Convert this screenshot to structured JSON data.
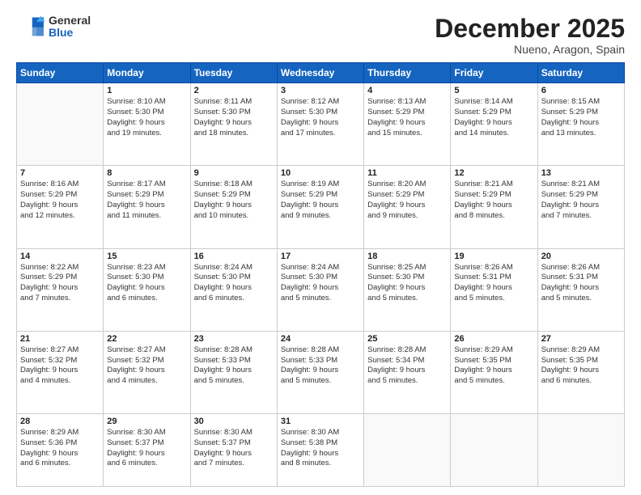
{
  "logo": {
    "general": "General",
    "blue": "Blue"
  },
  "header": {
    "month": "December 2025",
    "location": "Nueno, Aragon, Spain"
  },
  "weekdays": [
    "Sunday",
    "Monday",
    "Tuesday",
    "Wednesday",
    "Thursday",
    "Friday",
    "Saturday"
  ],
  "weeks": [
    [
      {
        "day": "",
        "info": ""
      },
      {
        "day": "1",
        "info": "Sunrise: 8:10 AM\nSunset: 5:30 PM\nDaylight: 9 hours\nand 19 minutes."
      },
      {
        "day": "2",
        "info": "Sunrise: 8:11 AM\nSunset: 5:30 PM\nDaylight: 9 hours\nand 18 minutes."
      },
      {
        "day": "3",
        "info": "Sunrise: 8:12 AM\nSunset: 5:30 PM\nDaylight: 9 hours\nand 17 minutes."
      },
      {
        "day": "4",
        "info": "Sunrise: 8:13 AM\nSunset: 5:29 PM\nDaylight: 9 hours\nand 15 minutes."
      },
      {
        "day": "5",
        "info": "Sunrise: 8:14 AM\nSunset: 5:29 PM\nDaylight: 9 hours\nand 14 minutes."
      },
      {
        "day": "6",
        "info": "Sunrise: 8:15 AM\nSunset: 5:29 PM\nDaylight: 9 hours\nand 13 minutes."
      }
    ],
    [
      {
        "day": "7",
        "info": "Sunrise: 8:16 AM\nSunset: 5:29 PM\nDaylight: 9 hours\nand 12 minutes."
      },
      {
        "day": "8",
        "info": "Sunrise: 8:17 AM\nSunset: 5:29 PM\nDaylight: 9 hours\nand 11 minutes."
      },
      {
        "day": "9",
        "info": "Sunrise: 8:18 AM\nSunset: 5:29 PM\nDaylight: 9 hours\nand 10 minutes."
      },
      {
        "day": "10",
        "info": "Sunrise: 8:19 AM\nSunset: 5:29 PM\nDaylight: 9 hours\nand 9 minutes."
      },
      {
        "day": "11",
        "info": "Sunrise: 8:20 AM\nSunset: 5:29 PM\nDaylight: 9 hours\nand 9 minutes."
      },
      {
        "day": "12",
        "info": "Sunrise: 8:21 AM\nSunset: 5:29 PM\nDaylight: 9 hours\nand 8 minutes."
      },
      {
        "day": "13",
        "info": "Sunrise: 8:21 AM\nSunset: 5:29 PM\nDaylight: 9 hours\nand 7 minutes."
      }
    ],
    [
      {
        "day": "14",
        "info": "Sunrise: 8:22 AM\nSunset: 5:29 PM\nDaylight: 9 hours\nand 7 minutes."
      },
      {
        "day": "15",
        "info": "Sunrise: 8:23 AM\nSunset: 5:30 PM\nDaylight: 9 hours\nand 6 minutes."
      },
      {
        "day": "16",
        "info": "Sunrise: 8:24 AM\nSunset: 5:30 PM\nDaylight: 9 hours\nand 6 minutes."
      },
      {
        "day": "17",
        "info": "Sunrise: 8:24 AM\nSunset: 5:30 PM\nDaylight: 9 hours\nand 5 minutes."
      },
      {
        "day": "18",
        "info": "Sunrise: 8:25 AM\nSunset: 5:30 PM\nDaylight: 9 hours\nand 5 minutes."
      },
      {
        "day": "19",
        "info": "Sunrise: 8:26 AM\nSunset: 5:31 PM\nDaylight: 9 hours\nand 5 minutes."
      },
      {
        "day": "20",
        "info": "Sunrise: 8:26 AM\nSunset: 5:31 PM\nDaylight: 9 hours\nand 5 minutes."
      }
    ],
    [
      {
        "day": "21",
        "info": "Sunrise: 8:27 AM\nSunset: 5:32 PM\nDaylight: 9 hours\nand 4 minutes."
      },
      {
        "day": "22",
        "info": "Sunrise: 8:27 AM\nSunset: 5:32 PM\nDaylight: 9 hours\nand 4 minutes."
      },
      {
        "day": "23",
        "info": "Sunrise: 8:28 AM\nSunset: 5:33 PM\nDaylight: 9 hours\nand 5 minutes."
      },
      {
        "day": "24",
        "info": "Sunrise: 8:28 AM\nSunset: 5:33 PM\nDaylight: 9 hours\nand 5 minutes."
      },
      {
        "day": "25",
        "info": "Sunrise: 8:28 AM\nSunset: 5:34 PM\nDaylight: 9 hours\nand 5 minutes."
      },
      {
        "day": "26",
        "info": "Sunrise: 8:29 AM\nSunset: 5:35 PM\nDaylight: 9 hours\nand 5 minutes."
      },
      {
        "day": "27",
        "info": "Sunrise: 8:29 AM\nSunset: 5:35 PM\nDaylight: 9 hours\nand 6 minutes."
      }
    ],
    [
      {
        "day": "28",
        "info": "Sunrise: 8:29 AM\nSunset: 5:36 PM\nDaylight: 9 hours\nand 6 minutes."
      },
      {
        "day": "29",
        "info": "Sunrise: 8:30 AM\nSunset: 5:37 PM\nDaylight: 9 hours\nand 6 minutes."
      },
      {
        "day": "30",
        "info": "Sunrise: 8:30 AM\nSunset: 5:37 PM\nDaylight: 9 hours\nand 7 minutes."
      },
      {
        "day": "31",
        "info": "Sunrise: 8:30 AM\nSunset: 5:38 PM\nDaylight: 9 hours\nand 8 minutes."
      },
      {
        "day": "",
        "info": ""
      },
      {
        "day": "",
        "info": ""
      },
      {
        "day": "",
        "info": ""
      }
    ]
  ]
}
